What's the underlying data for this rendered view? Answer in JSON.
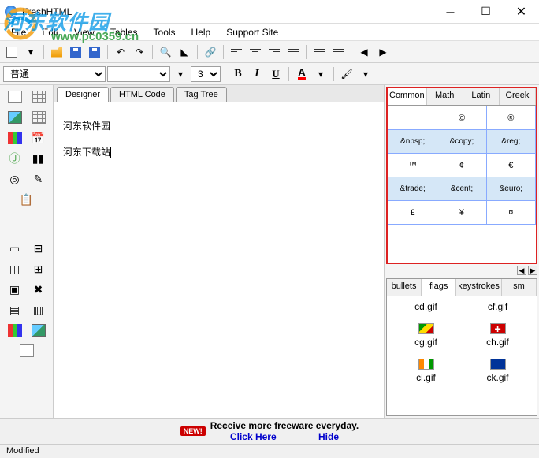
{
  "title": "FreshHTML",
  "watermark": "河东软件园",
  "watermark_url": "www.pc0359.cn",
  "menus": [
    "File",
    "Edit",
    "View",
    "Tables",
    "Tools",
    "Help",
    "Support Site"
  ],
  "format_select": "普通",
  "font_select": "",
  "size_select": "3",
  "bold": "B",
  "italic": "I",
  "underline": "U",
  "fontcolor": "A",
  "tabs": {
    "designer": "Designer",
    "html": "HTML Code",
    "tag": "Tag Tree"
  },
  "editor_lines": [
    "河东软件园",
    "河东下载站"
  ],
  "char_tabs": {
    "common": "Common",
    "math": "Math",
    "latin": "Latin",
    "greek": "Greek"
  },
  "char_rows": [
    {
      "sym": [
        "",
        "©",
        "®"
      ],
      "code": [
        "&nbsp;",
        "&copy;",
        "&reg;"
      ]
    },
    {
      "sym": [
        "™",
        "¢",
        "€"
      ],
      "code": [
        "&trade;",
        "&cent;",
        "&euro;"
      ]
    },
    {
      "sym": [
        "£",
        "¥",
        "¤"
      ],
      "code": [
        "",
        "",
        ""
      ]
    }
  ],
  "gallery_tabs": {
    "bullets": "bullets",
    "flags": "flags",
    "keys": "keystrokes",
    "sm": "sm"
  },
  "gallery_items": [
    {
      "name": "cd.gif"
    },
    {
      "name": "cf.gif"
    },
    {
      "name": "cg.gif",
      "flag": "cg"
    },
    {
      "name": "ch.gif",
      "flag": "ch"
    },
    {
      "name": "ci.gif",
      "flag": "ci"
    },
    {
      "name": "ck.gif",
      "flag": "ck"
    }
  ],
  "promo": {
    "new": "NEW!",
    "text": "Receive more freeware everyday.",
    "click": "Click Here",
    "hide": "Hide"
  },
  "status": "Modified"
}
